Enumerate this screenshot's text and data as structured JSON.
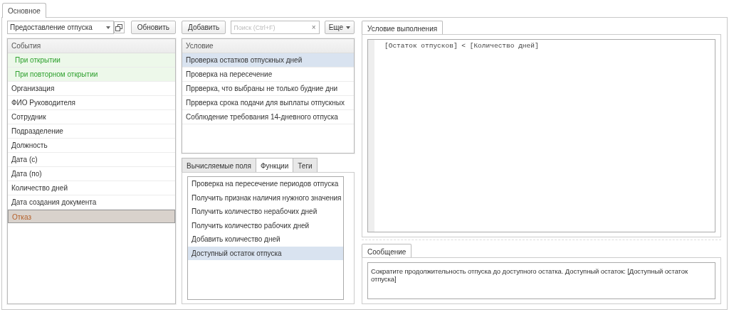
{
  "tabs": [
    {
      "label": "Основное",
      "selected": true
    }
  ],
  "toolbar_left": {
    "select_value": "Предоставление отпуска",
    "refresh_button": "Обновить"
  },
  "toolbar_middle": {
    "add_button": "Добавить",
    "search_placeholder": "Поиск (Ctrl+F)",
    "clear_button": "×",
    "more_button": "Еще"
  },
  "events": {
    "header": "События",
    "items": [
      {
        "label": "При открытии",
        "kind": "event",
        "selected": false
      },
      {
        "label": "При повторном открытии",
        "kind": "event",
        "selected": false
      },
      {
        "label": "Организация",
        "kind": "field",
        "selected": false
      },
      {
        "label": "ФИО Руководителя",
        "kind": "field",
        "selected": false
      },
      {
        "label": "Сотрудник",
        "kind": "field",
        "selected": false
      },
      {
        "label": "Подразделение",
        "kind": "field",
        "selected": false
      },
      {
        "label": "Должность",
        "kind": "field",
        "selected": false
      },
      {
        "label": "Дата (с)",
        "kind": "field",
        "selected": false
      },
      {
        "label": "Дата (по)",
        "kind": "field",
        "selected": false
      },
      {
        "label": "Количество дней",
        "kind": "field",
        "selected": false
      },
      {
        "label": "Дата создания документа",
        "kind": "field",
        "selected": false
      },
      {
        "label": "Отказ",
        "kind": "field",
        "selected": true
      }
    ]
  },
  "conditions": {
    "header": "Условие",
    "items": [
      {
        "label": "Проверка остатков отпускных дней",
        "selected": true
      },
      {
        "label": "Проверка на пересечение",
        "selected": false
      },
      {
        "label": "Пррверка, что выбраны не только будние дни",
        "selected": false
      },
      {
        "label": "Пррверка срока подачи для выплаты отпускных",
        "selected": false
      },
      {
        "label": "Соблюдение требования 14-дневного отпуска",
        "selected": false
      }
    ]
  },
  "lower_tabs": [
    {
      "label": "Вычисляемые поля",
      "selected": false
    },
    {
      "label": "Функции",
      "selected": true
    },
    {
      "label": "Теги",
      "selected": false
    }
  ],
  "functions": [
    {
      "label": "Проверка на пересечение периодов отпуска",
      "selected": false
    },
    {
      "label": "Получить признак наличия нужного значения",
      "selected": false
    },
    {
      "label": "Получить количество нерабочих дней",
      "selected": false
    },
    {
      "label": "Получить количество рабочих дней",
      "selected": false
    },
    {
      "label": "Добавить количество дней",
      "selected": false
    },
    {
      "label": "Доступный остаток отпуска",
      "selected": true
    }
  ],
  "condition_editor": {
    "tab": "Условие выполнения",
    "code": "[Остаток отпусков] < [Количество дней]"
  },
  "message": {
    "tab": "Сообщение",
    "text": "Сократите продолжительность отпуска до доступного остатка. Доступный остаток: [Доступный остаток отпуска]"
  }
}
